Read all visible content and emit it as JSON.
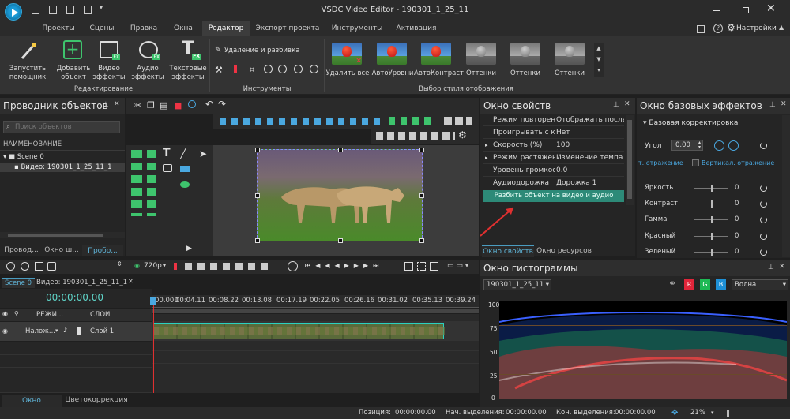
{
  "app": {
    "title": "VSDC Video Editor - 190301_1_25_11",
    "settings_label": "Настройки"
  },
  "menu": [
    "Проекты",
    "Сцены",
    "Правка",
    "Окна",
    "Редактор",
    "Экспорт проекта",
    "Инструменты",
    "Активация"
  ],
  "ribbon": {
    "wizard": "Запустить\nпомощник",
    "add_object": "Добавить\nобъект",
    "video_effects": "Видео\nэффекты",
    "audio_effects": "Аудио\nэффекты",
    "text_effects": "Текстовые\nэффекты",
    "group_edit": "Редактирование",
    "delete_split": "Удаление и разбивка",
    "group_tools": "Инструменты",
    "styles": [
      "Удалить все",
      "АвтоУровни",
      "АвтоКонтраст",
      "Оттенки",
      "Оттенки",
      "Оттенки"
    ],
    "group_styles": "Выбор стиля отображения"
  },
  "explorer": {
    "title": "Проводник объектов",
    "search_placeholder": "Поиск объектов",
    "column": "НАИМЕНОВАНИЕ",
    "tree": [
      "Scene 0",
      "Видео: 190301_1_25_11_1"
    ],
    "tabs": [
      "Провод...",
      "Окно ш...",
      "Пробо..."
    ]
  },
  "properties": {
    "title": "Окно свойств",
    "rows": [
      {
        "label": "Режим повторени",
        "value": "Отображать последн"
      },
      {
        "label": "Проигрывать с кс",
        "value": "Нет"
      },
      {
        "label": "Скорость (%)",
        "value": "100"
      },
      {
        "label": "Режим растяжени",
        "value": "Изменение темпа"
      },
      {
        "label": "Уровень громкос",
        "value": "0.0"
      },
      {
        "label": "Аудиодорожка",
        "value": "Дорожка 1"
      }
    ],
    "split_button": "Разбить объект на видео и аудио",
    "tabs": [
      "Окно свойств",
      "Окно ресурсов"
    ]
  },
  "effects": {
    "title": "Окно базовых эффектов",
    "section": "Базовая корректировка",
    "angle_label": "Угол",
    "angle_value": "0.00",
    "mirror_h": "т. отражение",
    "mirror_v": "Вертикал. отражение",
    "sliders": [
      {
        "label": "Яркость",
        "value": "0"
      },
      {
        "label": "Контраст",
        "value": "0"
      },
      {
        "label": "Гамма",
        "value": "0"
      },
      {
        "label": "Красный",
        "value": "0"
      },
      {
        "label": "Зеленый",
        "value": "0"
      }
    ]
  },
  "histogram": {
    "title": "Окно гистограммы",
    "source": "190301_1_25_11",
    "channels": [
      "R",
      "G",
      "B"
    ],
    "mode": "Волна",
    "scale": [
      "100",
      "75",
      "50",
      "25",
      "0"
    ],
    "colors": {
      "r": "#e0253a",
      "g": "#1db954",
      "b": "#1e90d6"
    }
  },
  "timeline": {
    "resolution": "720р",
    "scene_tab": "Scene 0",
    "video_tab": "Видео: 190301_1_25_11_1",
    "timecode": "00:00:00.00",
    "ruler": [
      "00.000",
      "00:04.11",
      "00:08.22",
      "00:13.08",
      "00:17.19",
      "00:22.05",
      "00:26.16",
      "00:31.02",
      "00:35.13",
      "00:39.24"
    ],
    "col_mode": "РЕЖИ...",
    "col_layers": "СЛОИ",
    "track_mode": "Налож...",
    "track_name": "Слой 1",
    "tabs": [
      "Окно таймлайна",
      "Цветокоррекция"
    ]
  },
  "status": {
    "position_label": "Позиция:",
    "position": "00:00:00.00",
    "sel_start_label": "Нач. выделения:",
    "sel_start": "00:00:00.00",
    "sel_end_label": "Кон. выделения:",
    "sel_end": "00:00:00.00",
    "zoom": "21%"
  }
}
